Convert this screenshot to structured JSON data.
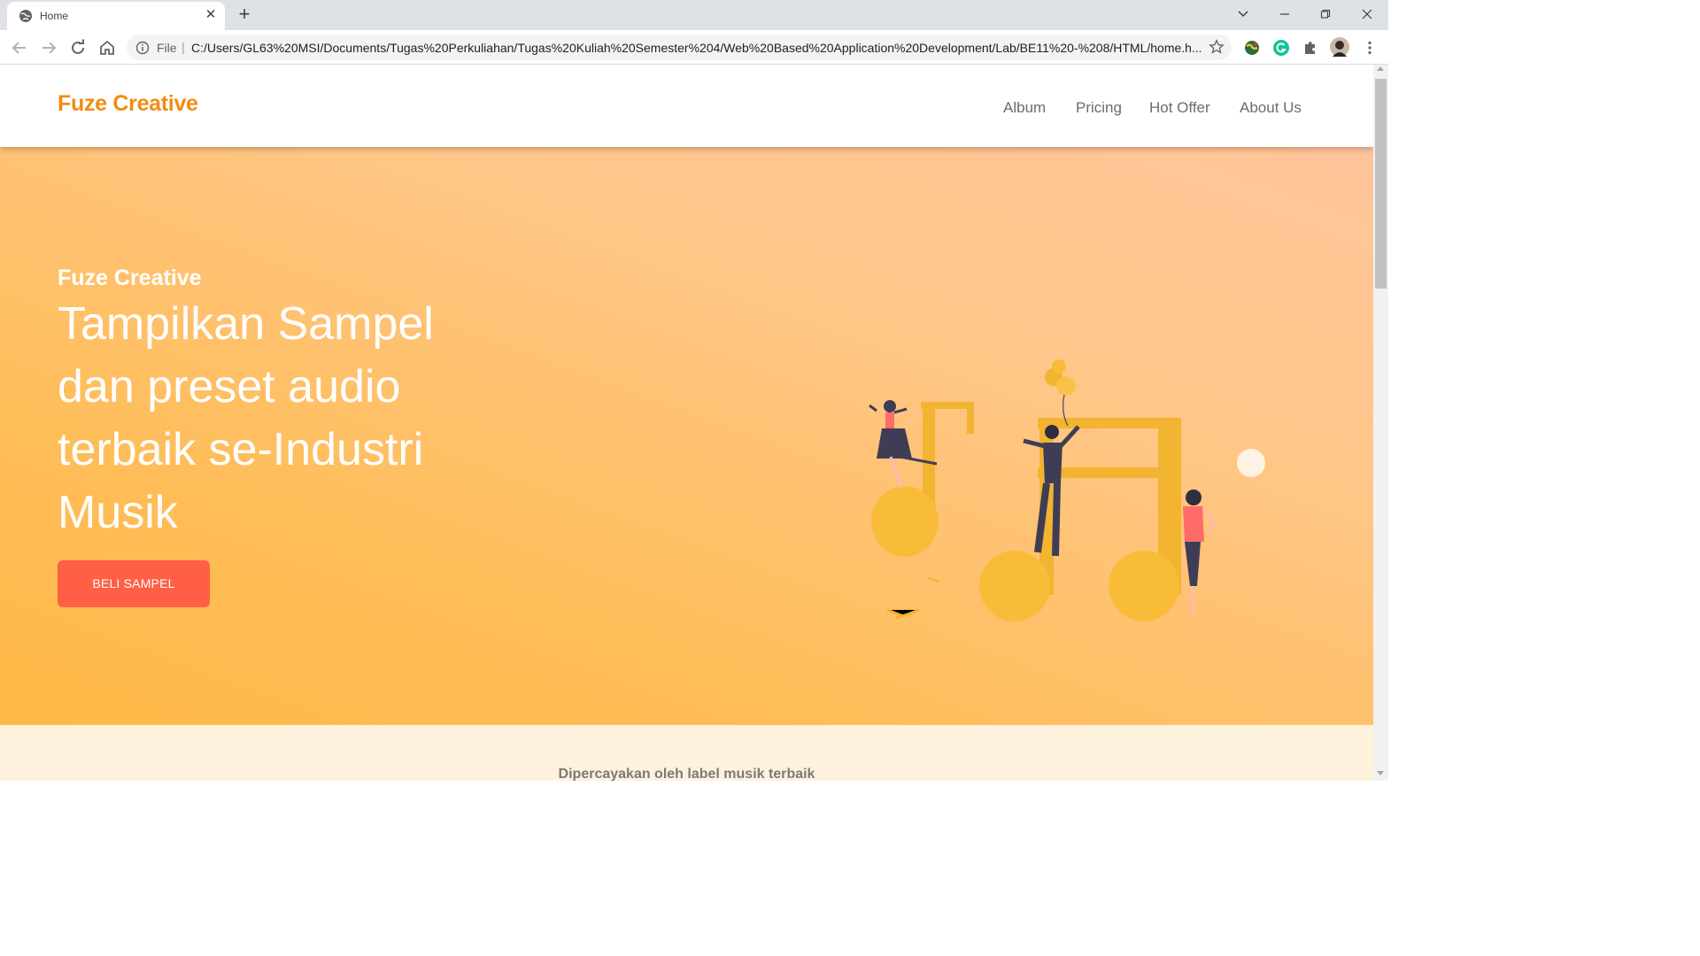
{
  "browser": {
    "tab_title": "Home",
    "file_label": "File",
    "url": "C:/Users/GL63%20MSI/Documents/Tugas%20Perkuliahan/Tugas%20Kuliah%20Semester%204/Web%20Based%20Application%20Development/Lab/BE11%20-%208/HTML/home.h..."
  },
  "header": {
    "brand": "Fuze Creative",
    "nav": [
      "Album",
      "Pricing",
      "Hot Offer",
      "About Us"
    ]
  },
  "hero": {
    "brand": "Fuze Creative",
    "lines": [
      "Tampilkan Sampel",
      "dan preset audio",
      "terbaik se-Industri",
      "Musik"
    ],
    "cta": "BELI SAMPEL"
  },
  "trusted": {
    "text": "Dipercayakan oleh label musik terbaik"
  },
  "colors": {
    "brand_orange": "#f28c12",
    "cta_red": "#ff5f45",
    "note_yellow": "#fbbf3a"
  },
  "icons": [
    "globe-icon",
    "close-icon",
    "plus-icon",
    "back-icon",
    "forward-icon",
    "reload-icon",
    "home-icon",
    "info-icon",
    "star-icon",
    "puzzle-icon",
    "menu-icon"
  ]
}
